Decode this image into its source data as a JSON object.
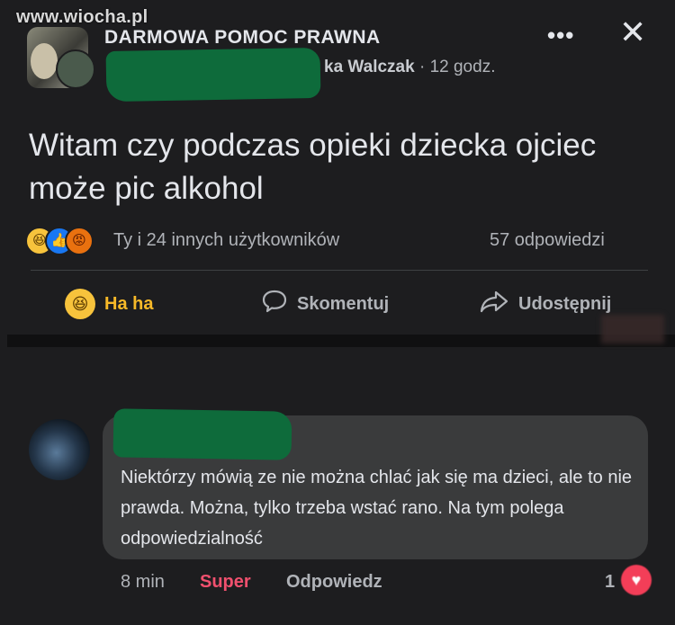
{
  "watermark": "www.wiocha.pl",
  "post": {
    "group_name": "DARMOWA POMOC PRAWNA",
    "author_name": "ka Walczak",
    "author_time": "· 12 godz.",
    "more_label": "•••",
    "close_label": "✕",
    "text": "Witam czy podczas opieki dziecka ojciec może pic alkohol",
    "reactions_summary": "Ty i 24 innych użytkowników",
    "comments_count": "57 odpowiedzi",
    "reaction_icons": [
      "haha-icon",
      "like-icon",
      "angry-icon"
    ]
  },
  "actions": {
    "haha": "Ha ha",
    "comment": "Skomentuj",
    "share": "Udostępnij"
  },
  "comment": {
    "text": "Niektórzy mówią ze nie można chlać jak się ma dzieci, ale to nie prawda. Można, tylko trzeba wstać rano. Na tym polega odpowiedzialność",
    "time": "8 min",
    "reaction_label": "Super",
    "reply_label": "Odpowiedz",
    "reaction_count": "1"
  },
  "colors": {
    "background": "#1d1d1f",
    "bubble": "#3a3b3c",
    "haha_accent": "#f7b928",
    "super_accent": "#f0506e",
    "redaction": "#0e6b3b"
  }
}
